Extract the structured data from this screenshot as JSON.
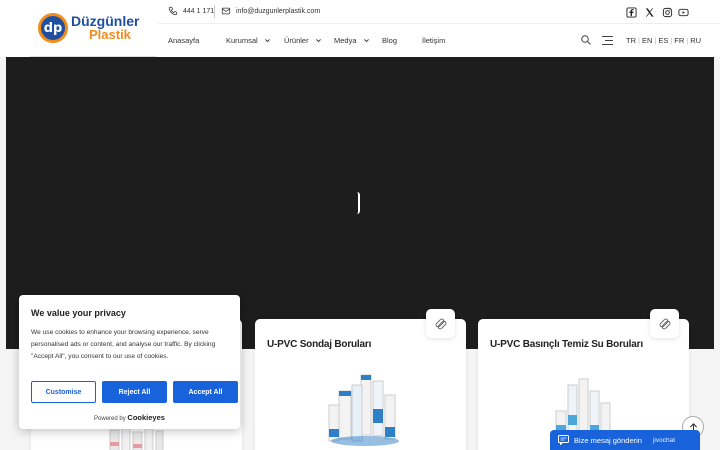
{
  "brand": {
    "line1": "Düzgünler",
    "line2": "Plastik",
    "mark": "dp",
    "primary_color": "#1f4fa0",
    "accent_color": "#f28c1b"
  },
  "topbar": {
    "phone": "444 1 171",
    "email": "info@duzgunlerplastik.com",
    "social_icons": [
      "facebook-icon",
      "x-icon",
      "instagram-icon",
      "youtube-icon"
    ]
  },
  "nav": {
    "items": [
      {
        "label": "Anasayfa",
        "has_dropdown": false
      },
      {
        "label": "Kurumsal",
        "has_dropdown": true
      },
      {
        "label": "Ürünler",
        "has_dropdown": true
      },
      {
        "label": "Medya",
        "has_dropdown": true
      },
      {
        "label": "Blog",
        "has_dropdown": false
      },
      {
        "label": "İletişim",
        "has_dropdown": false
      }
    ],
    "languages": [
      "TR",
      "EN",
      "ES",
      "FR",
      "RU"
    ]
  },
  "cards": [
    {
      "title": ""
    },
    {
      "title": "U-PVC Sondaj Boruları"
    },
    {
      "title": "U-PVC Basınçlı Temiz Su Boruları"
    }
  ],
  "cookie": {
    "title": "We value your privacy",
    "body": "We use cookies to enhance your browsing experience, serve personalised ads or content, and analyse our traffic. By clicking \"Accept All\", you consent to our use of cookies.",
    "customise": "Customise",
    "reject": "Reject All",
    "accept": "Accept All",
    "powered_by": "Powered by",
    "powered_brand": "Cookieyes",
    "button_color": "#1863dc"
  },
  "chat": {
    "label": "Bize mesaj gönderin",
    "brand": "jivochat"
  }
}
